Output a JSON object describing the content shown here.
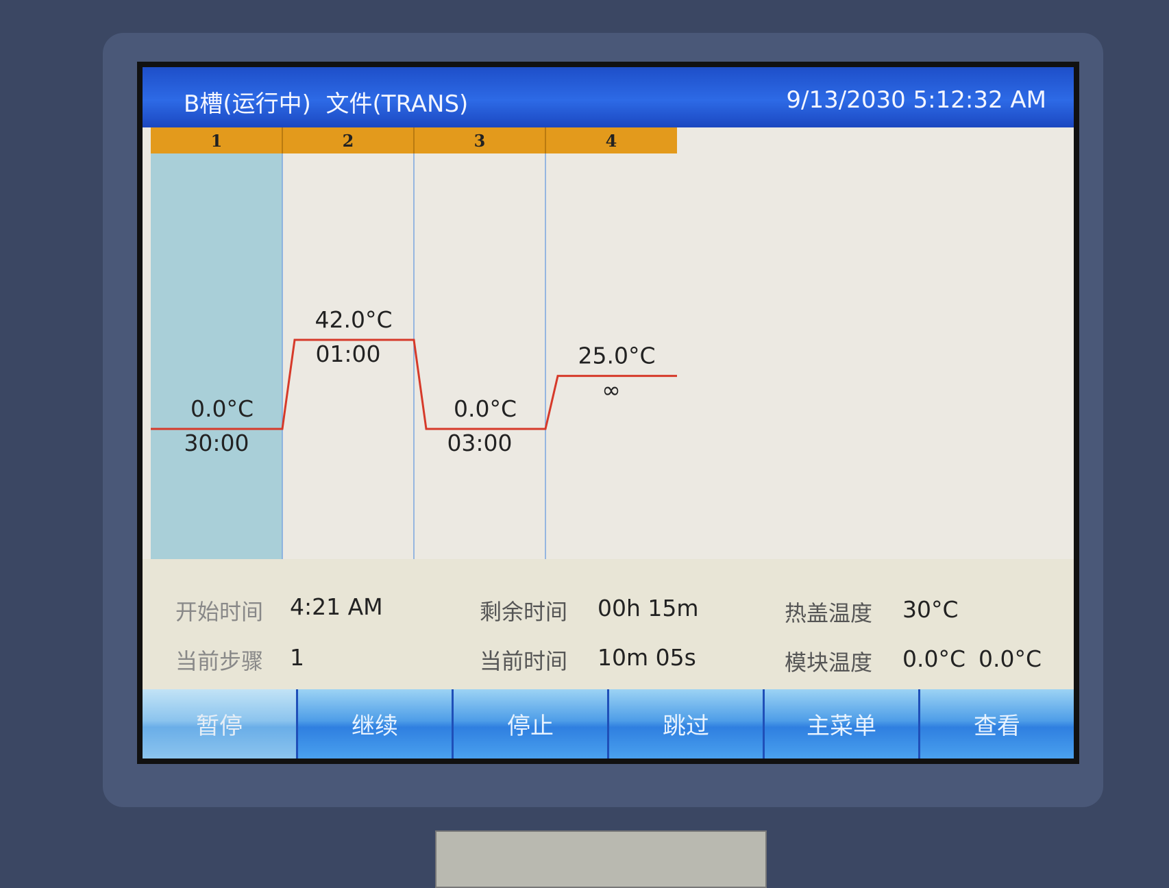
{
  "title": {
    "status": "B槽(运行中)",
    "file": "文件(TRANS)",
    "datetime": "9/13/2030 5:12:32 AM"
  },
  "steps": [
    {
      "num": "1",
      "temp": "0.0°C",
      "time": "30:00",
      "temp_c": 0.0,
      "active": true
    },
    {
      "num": "2",
      "temp": "42.0°C",
      "time": "01:00",
      "temp_c": 42.0,
      "active": false
    },
    {
      "num": "3",
      "temp": "0.0°C",
      "time": "03:00",
      "temp_c": 0.0,
      "active": false
    },
    {
      "num": "4",
      "temp": "25.0°C",
      "time": "∞",
      "temp_c": 25.0,
      "active": false
    }
  ],
  "info": {
    "start_time_label": "开始时间",
    "start_time": "4:21 AM",
    "remaining_label": "剩余时间",
    "remaining": "00h 15m",
    "lid_temp_label": "热盖温度",
    "lid_temp": "30°C",
    "current_step_label": "当前步骤",
    "current_step": "1",
    "current_time_label": "当前时间",
    "current_time": "10m 05s",
    "block_temp_label": "模块温度",
    "block_temp_a": "0.0°C",
    "block_temp_b": "0.0°C"
  },
  "buttons": {
    "pause": "暂停",
    "resume": "继续",
    "stop": "停止",
    "skip": "跳过",
    "main_menu": "主菜单",
    "view": "查看"
  },
  "colors": {
    "step_header": "#e39a1c",
    "active_step": "#a9cfd8",
    "temp_line": "#d63a2a",
    "divider": "#7aa6e0"
  }
}
